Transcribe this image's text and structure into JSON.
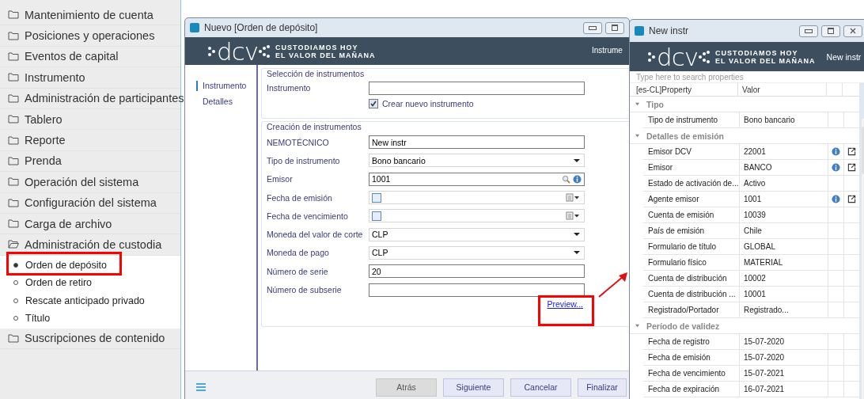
{
  "sidebar": {
    "items": [
      {
        "label": "Mantenimiento de cuenta",
        "expanded": false
      },
      {
        "label": "Posiciones y operaciones",
        "expanded": false
      },
      {
        "label": "Eventos de capital",
        "expanded": false
      },
      {
        "label": "Instrumento",
        "expanded": false
      },
      {
        "label": "Administración de participantes",
        "expanded": false
      },
      {
        "label": "Tablero",
        "expanded": false
      },
      {
        "label": "Reporte",
        "expanded": false
      },
      {
        "label": "Prenda",
        "expanded": false
      },
      {
        "label": "Operación del sistema",
        "expanded": false
      },
      {
        "label": "Configuración del sistema",
        "expanded": false
      },
      {
        "label": "Carga de archivo",
        "expanded": false
      },
      {
        "label": "Administración de custodia",
        "expanded": true,
        "children": [
          {
            "label": "Orden de depósito",
            "selected": true
          },
          {
            "label": "Orden de retiro",
            "selected": false
          },
          {
            "label": "Rescate anticipado privado",
            "selected": false
          },
          {
            "label": "Título",
            "selected": false
          }
        ]
      },
      {
        "label": "Suscripciones de contenido",
        "expanded": false
      }
    ]
  },
  "dialog": {
    "title": "Nuevo [Orden de depósito]",
    "logo": {
      "mark": "dcv",
      "tagline": [
        "CUSTODIAMOS HOY",
        "EL VALOR DEL MAÑANA"
      ]
    },
    "banner_text": "Instrume",
    "nav": [
      {
        "label": "Instrumento",
        "selected": true
      },
      {
        "label": "Detalles",
        "selected": false
      }
    ],
    "sections": [
      {
        "title": "Selección de instrumentos",
        "fields": [
          {
            "kind": "text",
            "label": "Instrumento"
          },
          {
            "kind": "checkbox",
            "text": "Crear nuevo instrumento",
            "checked": true
          }
        ]
      },
      {
        "title": "Creación de instrumentos",
        "fields": [
          {
            "kind": "text",
            "label": "NEMOTÉCNICO",
            "value": "New instr"
          },
          {
            "kind": "dropdown",
            "label": "Tipo de instrumento",
            "value": "Bono bancario"
          },
          {
            "kind": "lookup",
            "label": "Emisor",
            "value": "1001"
          },
          {
            "kind": "date",
            "label": "Fecha de emisión",
            "checked": false
          },
          {
            "kind": "date",
            "label": "Fecha de vencimiento",
            "checked": false
          },
          {
            "kind": "dropdown",
            "label": "Moneda del valor de corte",
            "value": "CLP"
          },
          {
            "kind": "dropdown",
            "label": "Moneda de pago",
            "value": "CLP"
          },
          {
            "kind": "text",
            "label": "Número de serie",
            "value": "20"
          },
          {
            "kind": "text",
            "label": "Número de subserie"
          }
        ],
        "link": "Preview..."
      }
    ],
    "buttons": [
      {
        "label": "Atrás",
        "disabled": true
      },
      {
        "label": "Siguiente",
        "disabled": false
      },
      {
        "label": "Cancelar",
        "disabled": false
      },
      {
        "label": "Finalizar",
        "disabled": false
      }
    ]
  },
  "properties": {
    "title": "New instr",
    "logo": {
      "mark": "dcv",
      "tagline": [
        "CUSTODIAMOS HOY",
        "EL VALOR DEL MAÑANA"
      ]
    },
    "banner_text": "New instr",
    "search": {
      "placeholder": "Type here to search properties"
    },
    "columns": [
      "[es-CL]Property",
      "Valor"
    ],
    "groups": [
      {
        "name": "Tipo",
        "expanded": true,
        "rows": [
          {
            "property": "Tipo de instrumento",
            "value": "Bono bancario",
            "info": false,
            "link": false
          }
        ]
      },
      {
        "name": "Detalles de emisión",
        "expanded": true,
        "rows": [
          {
            "property": "Emisor DCV",
            "value": "22001",
            "info": true,
            "link": true
          },
          {
            "property": "Emisor",
            "value": "BANCO",
            "info": true,
            "link": true
          },
          {
            "property": "Estado de activación de...",
            "value": "Activo",
            "info": false,
            "link": false
          },
          {
            "property": "Agente emisor",
            "value": "1001",
            "info": true,
            "link": true
          },
          {
            "property": "Cuenta de emisión",
            "value": "10039",
            "info": false,
            "link": false
          },
          {
            "property": "País de emisión",
            "value": "Chile",
            "info": false,
            "link": false
          },
          {
            "property": "Formulario de título",
            "value": "GLOBAL",
            "info": false,
            "link": false
          },
          {
            "property": "Formulario físico",
            "value": "MATERIAL",
            "info": false,
            "link": false
          },
          {
            "property": "Cuenta de distribución",
            "value": "10002",
            "info": false,
            "link": false
          },
          {
            "property": "Cuenta de distribución ...",
            "value": "10001",
            "info": false,
            "link": false
          },
          {
            "property": "Registrado/Portador",
            "value": "Registrado...",
            "info": false,
            "link": false
          }
        ]
      },
      {
        "name": "Período de validez",
        "expanded": true,
        "rows": [
          {
            "property": "Fecha de registro",
            "value": "15-07-2020",
            "info": false,
            "link": false
          },
          {
            "property": "Fecha de emisión",
            "value": "15-07-2020",
            "info": false,
            "link": false
          },
          {
            "property": "Fecha de vencimiento",
            "value": "15-07-2021",
            "info": false,
            "link": false
          },
          {
            "property": "Fecha de expiración",
            "value": "16-07-2021",
            "info": false,
            "link": false
          }
        ]
      }
    ]
  }
}
